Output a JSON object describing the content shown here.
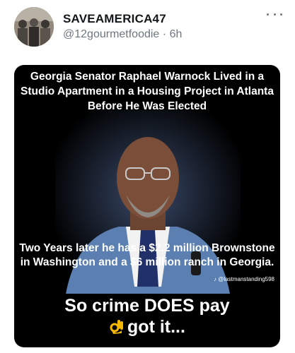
{
  "tweet": {
    "username": "SAVEAMERICA47",
    "handle": "@12gourmetfoodie",
    "separator": "·",
    "time": "6h"
  },
  "icons": {
    "avatar": "group-photo-avatar",
    "more": "more-horizontal-icon",
    "emoji": "ok-hand-emoji",
    "watermark_logo": "tiktok-icon"
  },
  "meme": {
    "headline": "Georgia Senator Raphael Warnock Lived in a Studio Apartment in a Housing Project in Atlanta Before He Was Elected",
    "caption": "Two Years later he has a $2.2 million Brownstone in Washington and a $6 million ranch in Georgia.",
    "watermark": "@lastmanstanding598",
    "punchline_line1": "So crime DOES pay",
    "punchline_line2": "got it..."
  },
  "colors": {
    "text_primary": "#14171a",
    "text_secondary": "#6e767d",
    "media_background": "#000000"
  }
}
